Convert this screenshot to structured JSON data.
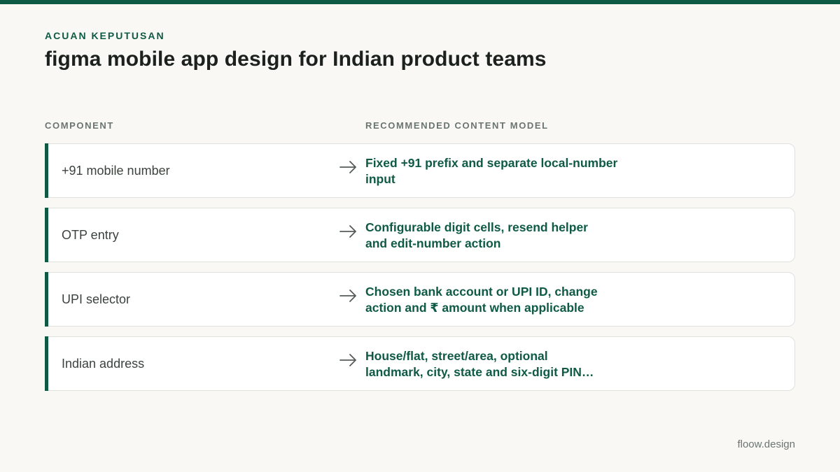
{
  "eyebrow": "ACUAN KEPUTUSAN",
  "title": "figma mobile app design for Indian product teams",
  "columns": {
    "component": "COMPONENT",
    "model": "RECOMMENDED CONTENT MODEL"
  },
  "rows": [
    {
      "component": "+91 mobile number",
      "model_line1": "Fixed +91 prefix and separate local-number",
      "model_line2": "input"
    },
    {
      "component": "OTP entry",
      "model_line1": "Configurable digit cells, resend helper",
      "model_line2": "and edit-number action"
    },
    {
      "component": "UPI selector",
      "model_line1": "Chosen bank account or UPI ID, change",
      "model_line2": "action and ₹ amount when applicable"
    },
    {
      "component": "Indian address",
      "model_line1": "House/flat, street/area, optional",
      "model_line2": "landmark, city, state and six-digit PIN…"
    }
  ],
  "icons": {
    "row_arrow": "arrow-right-icon"
  },
  "colors": {
    "accent": "#0f5a45",
    "background": "#f9f8f5",
    "muted": "#6b7570"
  },
  "brand": "floow.design"
}
